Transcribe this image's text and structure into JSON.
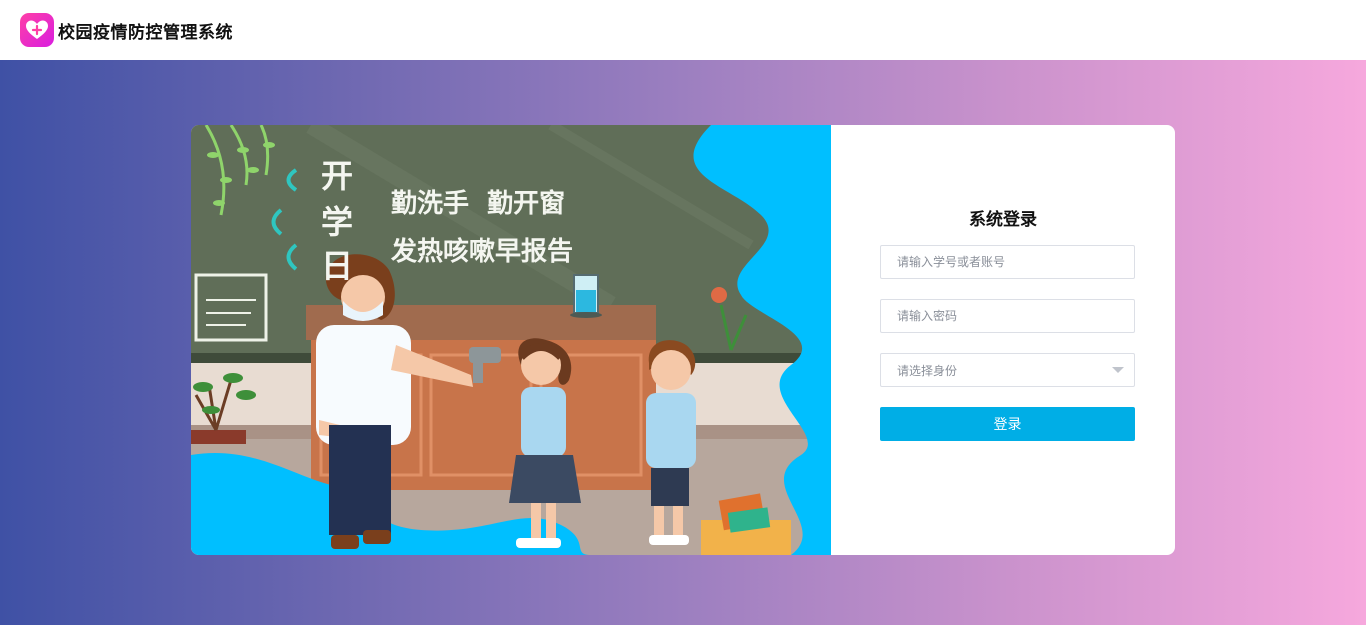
{
  "app": {
    "title": "校园疫情防控管理系统",
    "logo_icon": "heart-plus-icon",
    "accent": "#ff3fa6"
  },
  "illustration": {
    "chalk_vertical": [
      "开",
      "学",
      "日"
    ],
    "chalk_line1": "勤洗手  勤开窗",
    "chalk_line2": "发热咳嗽早报告",
    "wave_color": "#00bfff"
  },
  "login": {
    "title": "系统登录",
    "account_placeholder": "请输入学号或者账号",
    "password_placeholder": "请输入密码",
    "role_placeholder": "请选择身份",
    "submit_label": "登录",
    "button_color": "#00aee6"
  }
}
